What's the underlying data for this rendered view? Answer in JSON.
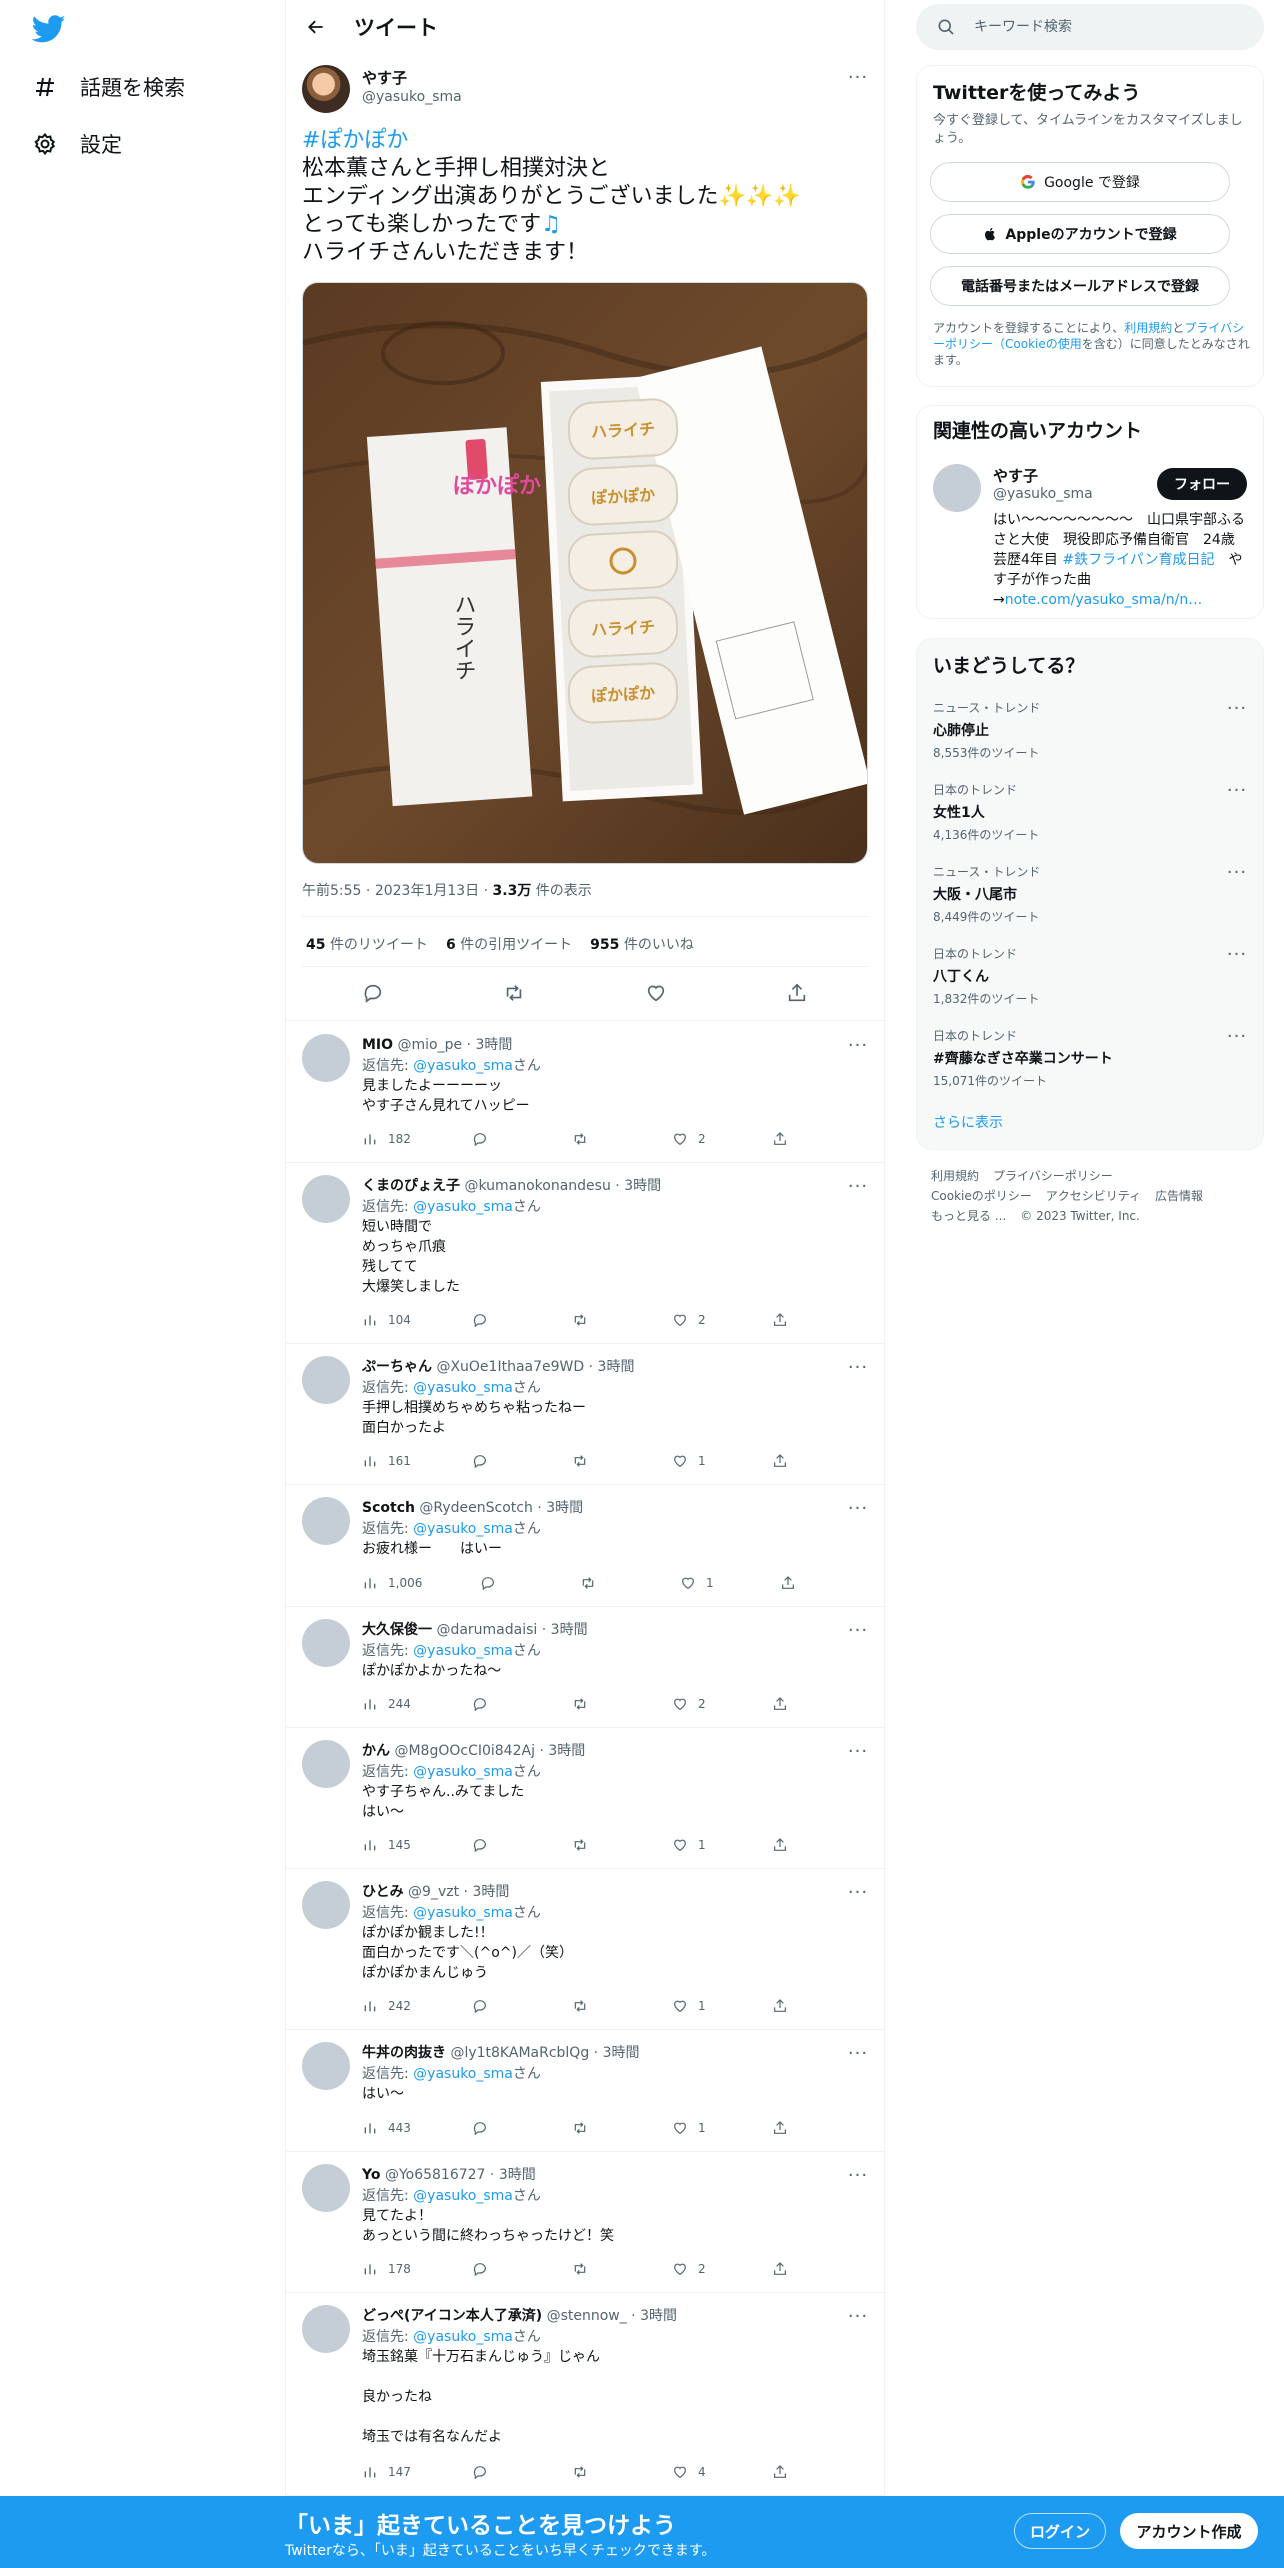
{
  "nav": {
    "explore_label": "話題を検索",
    "settings_label": "設定"
  },
  "header": {
    "title": "ツイート"
  },
  "tweet": {
    "author_name": "やす子",
    "author_handle": "@yasuko_sma",
    "hashtag": "#ぽかぽか",
    "lines": [
      "松本薫さんと手押し相撲対決と",
      "エンディング出演ありがとうございました",
      "とっても楽しかったです",
      "ハライチさんいただきます！"
    ],
    "time": "午前5:55",
    "date": "2023年1月13日",
    "views_count": "3.3万",
    "views_label": "件の表示",
    "retweets_count": "45",
    "retweets_label": "件のリツイート",
    "quotes_count": "6",
    "quotes_label": "件の引用ツイート",
    "likes_count": "955",
    "likes_label": "件のいいね",
    "image": {
      "package_text": "ハライチ",
      "logo_text": "ぽかぽか",
      "cake_labels": [
        "ハライチ",
        "ぽかぽか",
        "",
        "ハライチ",
        "ぽかぽか"
      ]
    }
  },
  "reply_to_label": "返信先: ",
  "reply_to_mention": "@yasuko_sma",
  "reply_to_suffix": "さん",
  "replies": [
    {
      "name": "MIO",
      "handle": "@mio_pe",
      "time": "3時間",
      "body": "見ましたよーーーーッ\nやす子さん見れてハッピー",
      "views": "182",
      "likes": "2"
    },
    {
      "name": "くまのぴょえ子",
      "handle": "@kumanokonandesu",
      "time": "3時間",
      "body": "短い時間で\nめっちゃ爪痕\n残してて\n大爆笑しました",
      "views": "104",
      "likes": "2"
    },
    {
      "name": "ぷーちゃん",
      "handle": "@XuOe1Ithaa7e9WD",
      "time": "3時間",
      "body": "手押し相撲めちゃめちゃ粘ったねー\n面白かったよ",
      "views": "161",
      "likes": "1"
    },
    {
      "name": "Scotch",
      "handle": "@RydeenScotch",
      "time": "3時間",
      "body": "お疲れ様ー　　はいー",
      "views": "1,006",
      "likes": "1"
    },
    {
      "name": "大久保俊一",
      "handle": "@darumadaisi",
      "time": "3時間",
      "body": "ぽかぽかよかったね〜",
      "views": "244",
      "likes": "2"
    },
    {
      "name": "かん",
      "handle": "@M8gOOcCI0i842Aj",
      "time": "3時間",
      "body": "やす子ちゃん..みてました\nはい〜",
      "views": "145",
      "likes": "1"
    },
    {
      "name": "ひとみ",
      "handle": "@9_vzt",
      "time": "3時間",
      "body": "ぽかぽか観ました!！\n面白かったです＼(^o^)／（笑）\nぽかぽかまんじゅう",
      "views": "242",
      "likes": "1"
    },
    {
      "name": "牛丼の肉抜き",
      "handle": "@ly1t8KAMaRcblQg",
      "time": "3時間",
      "body": "はい〜",
      "views": "443",
      "likes": "1"
    },
    {
      "name": "Yo",
      "handle": "@Yo65816727",
      "time": "3時間",
      "body": "見てたよ！\nあっという間に終わっちゃったけど！笑",
      "views": "178",
      "likes": "2"
    },
    {
      "name": "どっぺ(アイコン本人了承済)",
      "handle": "@stennow_",
      "time": "3時間",
      "body": "埼玉銘菓『十万石まんじゅう』じゃん\n\n良かったね\n\n埼玉では有名なんだよ",
      "views": "147",
      "likes": "4"
    }
  ],
  "search": {
    "placeholder": "キーワード検索"
  },
  "signup": {
    "title": "Twitterを使ってみよう",
    "subtitle": "今すぐ登録して、タイムラインをカスタマイズしましょう。",
    "google_label": "Google で登録",
    "apple_label": "Appleのアカウントで登録",
    "phone_label": "電話番号またはメールアドレスで登録",
    "legal_prefix": "アカウントを登録することにより、",
    "legal_terms": "利用規約",
    "legal_and": "と",
    "legal_privacy": "プライバシーポリシー",
    "legal_cookie_open": "（",
    "legal_cookie": "Cookieの使用",
    "legal_suffix": "を含む）に同意したとみなされます。"
  },
  "related": {
    "title": "関連性の高いアカウント",
    "name": "やす子",
    "handle": "@yasuko_sma",
    "follow_label": "フォロー",
    "bio_1": "はい〜〜〜〜〜〜〜〜　山口県宇部ふるさと大使　現役即応予備自衛官　24歳　芸歴4年目 ",
    "bio_tag": "#鉄フライパン育成日記",
    "bio_2": "　やす子が作った曲→",
    "bio_link": "note.com/yasuko_sma/n/n…"
  },
  "trends": {
    "title": "いまどうしてる？",
    "items": [
      {
        "category": "ニュース・トレンド",
        "name": "心肺停止",
        "count": "8,553件のツイート"
      },
      {
        "category": "日本のトレンド",
        "name": "女性1人",
        "count": "4,136件のツイート"
      },
      {
        "category": "ニュース・トレンド",
        "name": "大阪・八尾市",
        "count": "8,449件のツイート"
      },
      {
        "category": "日本のトレンド",
        "name": "八丁くん",
        "count": "1,832件のツイート"
      },
      {
        "category": "日本のトレンド",
        "name": "#齊藤なぎさ卒業コンサート",
        "count": "15,071件のツイート"
      }
    ],
    "show_more": "さらに表示"
  },
  "footer": {
    "terms": "利用規約",
    "privacy": "プライバシーポリシー",
    "cookie": "Cookieのポリシー",
    "accessibility": "アクセシビリティ",
    "ads": "広告情報",
    "more": "もっと見る ...",
    "copyright": "© 2023 Twitter, Inc."
  },
  "bottom_bar": {
    "title": "「いま」起きていることを見つけよう",
    "subtitle": "Twitterなら、「いま」起きていることをいち早くチェックできます。",
    "login_label": "ログイン",
    "signup_label": "アカウント作成"
  },
  "colors": {
    "brand": "#1d9bf0",
    "text": "#0f1419",
    "secondary": "#536471",
    "border": "#eff3f4"
  }
}
